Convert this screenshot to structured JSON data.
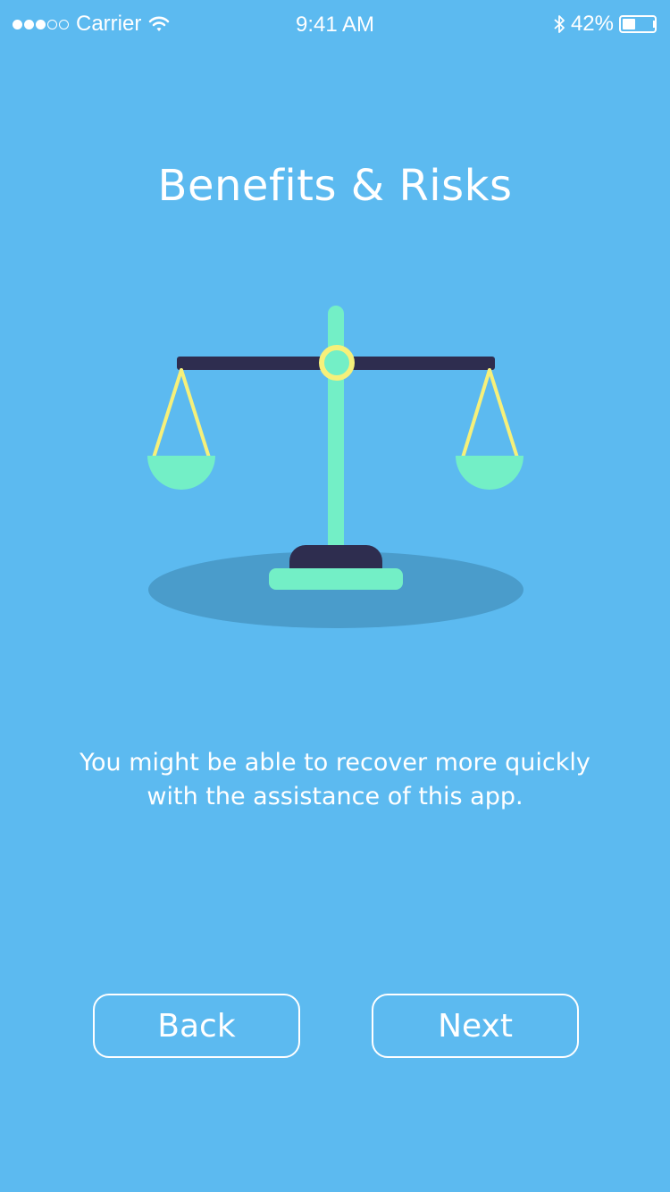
{
  "status_bar": {
    "signal_filled": 3,
    "signal_empty": 2,
    "carrier": "Carrier",
    "time": "9:41 AM",
    "battery_text": "42%",
    "battery_level": 0.42,
    "icons": [
      "wifi-icon",
      "bluetooth-icon",
      "battery-icon"
    ]
  },
  "page": {
    "title": "Benefits & Risks",
    "description": "You might be able to recover more quickly with the assistance of this app."
  },
  "buttons": {
    "back_label": "Back",
    "next_label": "Next"
  },
  "colors": {
    "background": "#5cbaf0",
    "shadow": "#4a9ccb",
    "scale_beam": "#2e2d4f",
    "scale_mint": "#73efc6",
    "scale_yellow": "#f6f07a",
    "text": "#ffffff"
  },
  "illustration": {
    "icon": "balance-scale-illustration"
  }
}
